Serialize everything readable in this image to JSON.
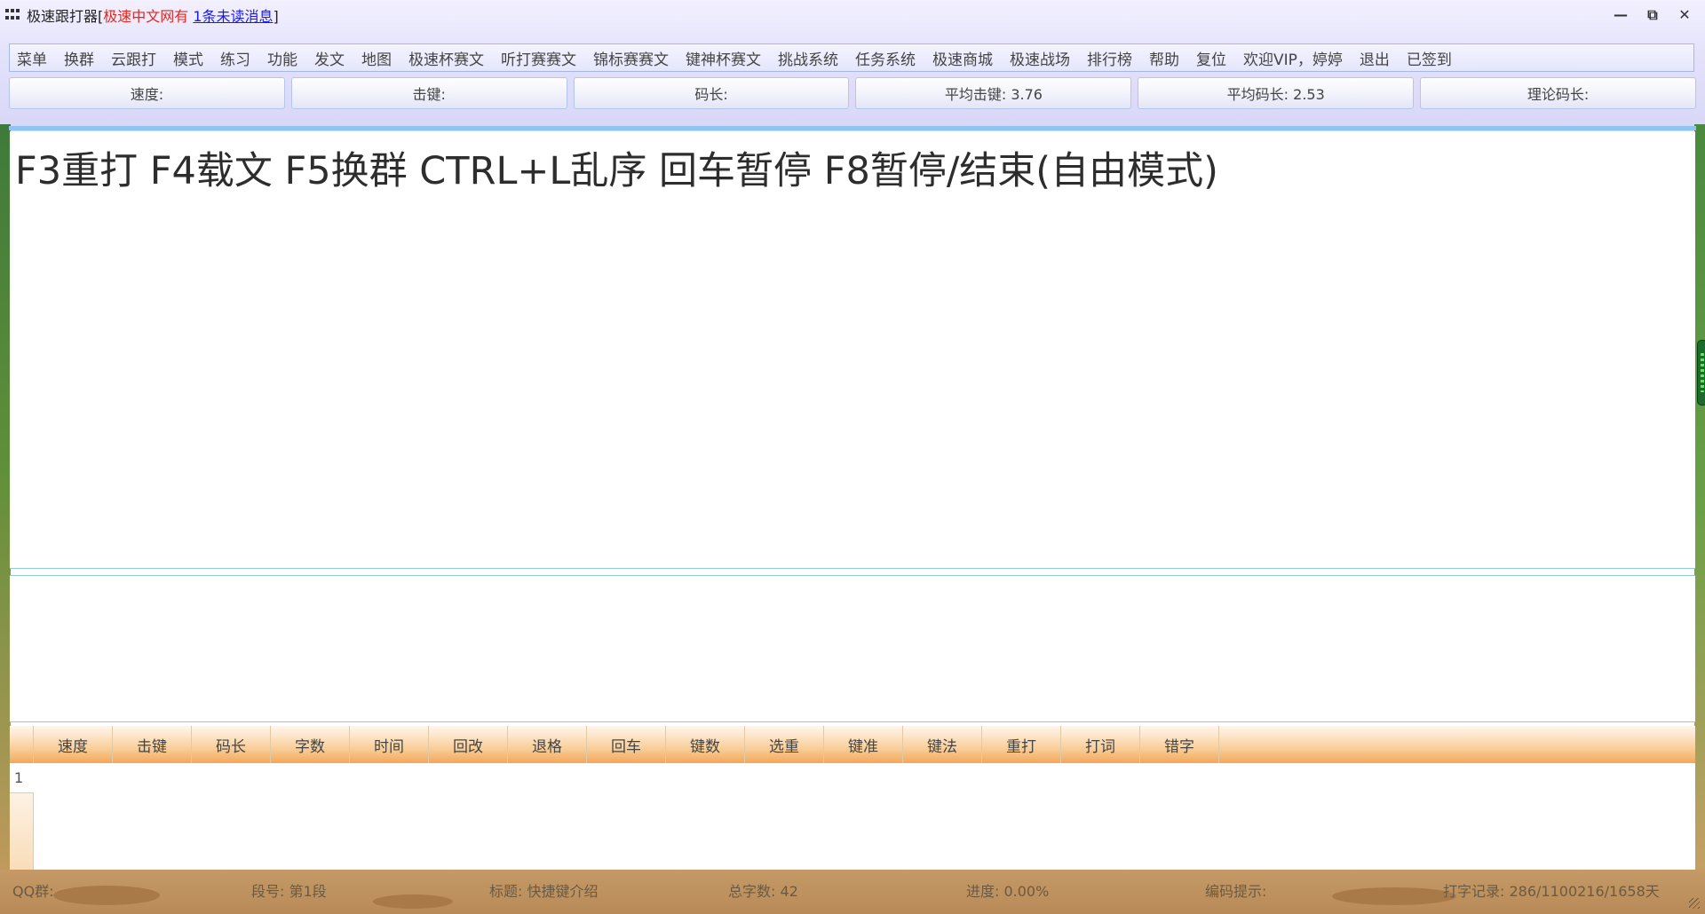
{
  "window": {
    "title_prefix": "极速跟打器[",
    "title_red": "极速中文网有",
    "title_link": "1条未读消息",
    "title_suffix": "]",
    "minimize_icon": "minimize-icon",
    "restore_icon": "restore-icon",
    "close_icon": "close-icon"
  },
  "menu": {
    "items": [
      "菜单",
      "换群",
      "云跟打",
      "模式",
      "练习",
      "功能",
      "发文",
      "地图",
      "极速杯赛文",
      "听打赛赛文",
      "锦标赛赛文",
      "键神杯赛文",
      "挑战系统",
      "任务系统",
      "极速商城",
      "极速战场",
      "排行榜",
      "帮助",
      "复位",
      "欢迎VIP，婷婷",
      "退出",
      "已签到"
    ]
  },
  "stats": {
    "speed": "速度:",
    "keystroke": "击键:",
    "code_length": "码长:",
    "avg_keystroke": "平均击键: 3.76",
    "avg_code_length": "平均码长: 2.53",
    "theory_code_length": "理论码长:"
  },
  "passage": {
    "text": "F3重打 F4载文 F5换群 CTRL+L乱序 回车暂停 F8暂停/结束(自由模式)"
  },
  "grid": {
    "columns": [
      "速度",
      "击键",
      "码长",
      "字数",
      "时间",
      "回改",
      "退格",
      "回车",
      "键数",
      "选重",
      "键准",
      "键法",
      "重打",
      "打词",
      "错字"
    ],
    "rows": [
      "1"
    ]
  },
  "status": {
    "qq_group": "QQ群:",
    "segment": "段号: 第1段",
    "title": "标题: 快捷键介绍",
    "total_chars": "总字数: 42",
    "progress": "进度: 0.00%",
    "encode_hint": "编码提示:",
    "typing_record": "打字记录: 286/1100216/1658天"
  },
  "colors": {
    "title_red": "#e1271e",
    "title_link": "#1a1aee",
    "menu_border": "#a7b8e6",
    "grid_header_orange": "#f3a75a",
    "divider_blue": "#8ec6ee"
  }
}
